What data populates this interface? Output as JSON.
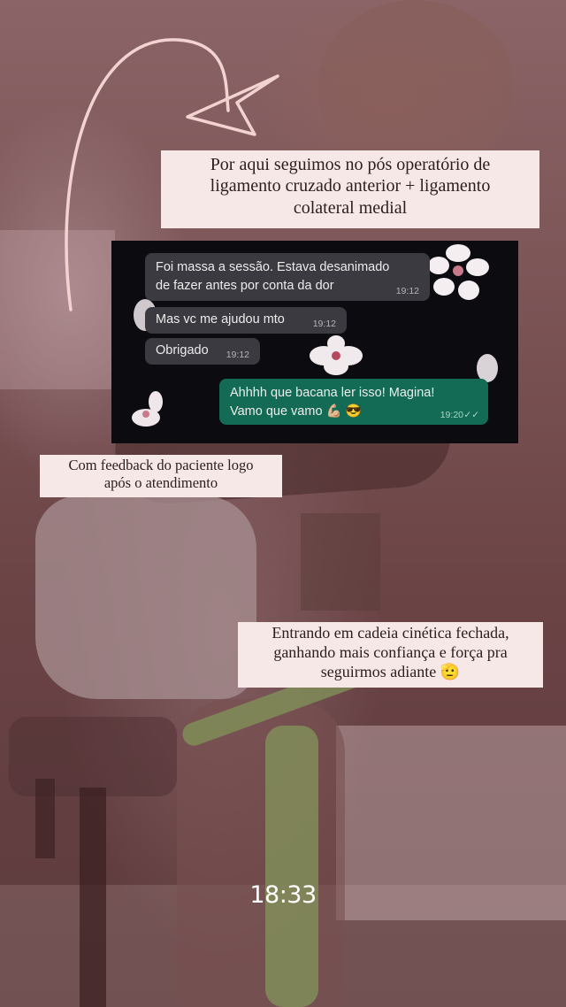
{
  "story": {
    "caption_top_lines": [
      "Por aqui seguimos no pós operatório de",
      "ligamento cruzado anterior + ligamento",
      "colateral medial"
    ],
    "caption_middle_lines": [
      "Com feedback do paciente logo",
      "após o atendimento"
    ],
    "caption_bottom_lines": [
      "Entrando em cadeia cinética fechada,",
      "ganhando mais confiança e força pra",
      "seguirmos adiante 🫡"
    ],
    "time_sticker": "18:33"
  },
  "chat": {
    "messages": [
      {
        "direction": "in",
        "lines": [
          "Foi massa a sessão. Estava desanimado",
          "de fazer antes por conta da dor"
        ],
        "time": "19:12"
      },
      {
        "direction": "in",
        "lines": [
          "Mas vc me ajudou mto"
        ],
        "time": "19:12"
      },
      {
        "direction": "in",
        "lines": [
          "Obrigado"
        ],
        "time": "19:12"
      },
      {
        "direction": "out",
        "lines": [
          "Ahhhh que bacana ler isso! Magina!",
          "Vamo que vamo 💪🏼 😎"
        ],
        "time": "19:20",
        "ticks": "✓✓"
      }
    ]
  },
  "colors": {
    "caption_bg": "#f6e8e6",
    "incoming_bubble": "#3a3a40",
    "outgoing_bubble": "#136b55",
    "arrow": "#f3d2d2"
  }
}
